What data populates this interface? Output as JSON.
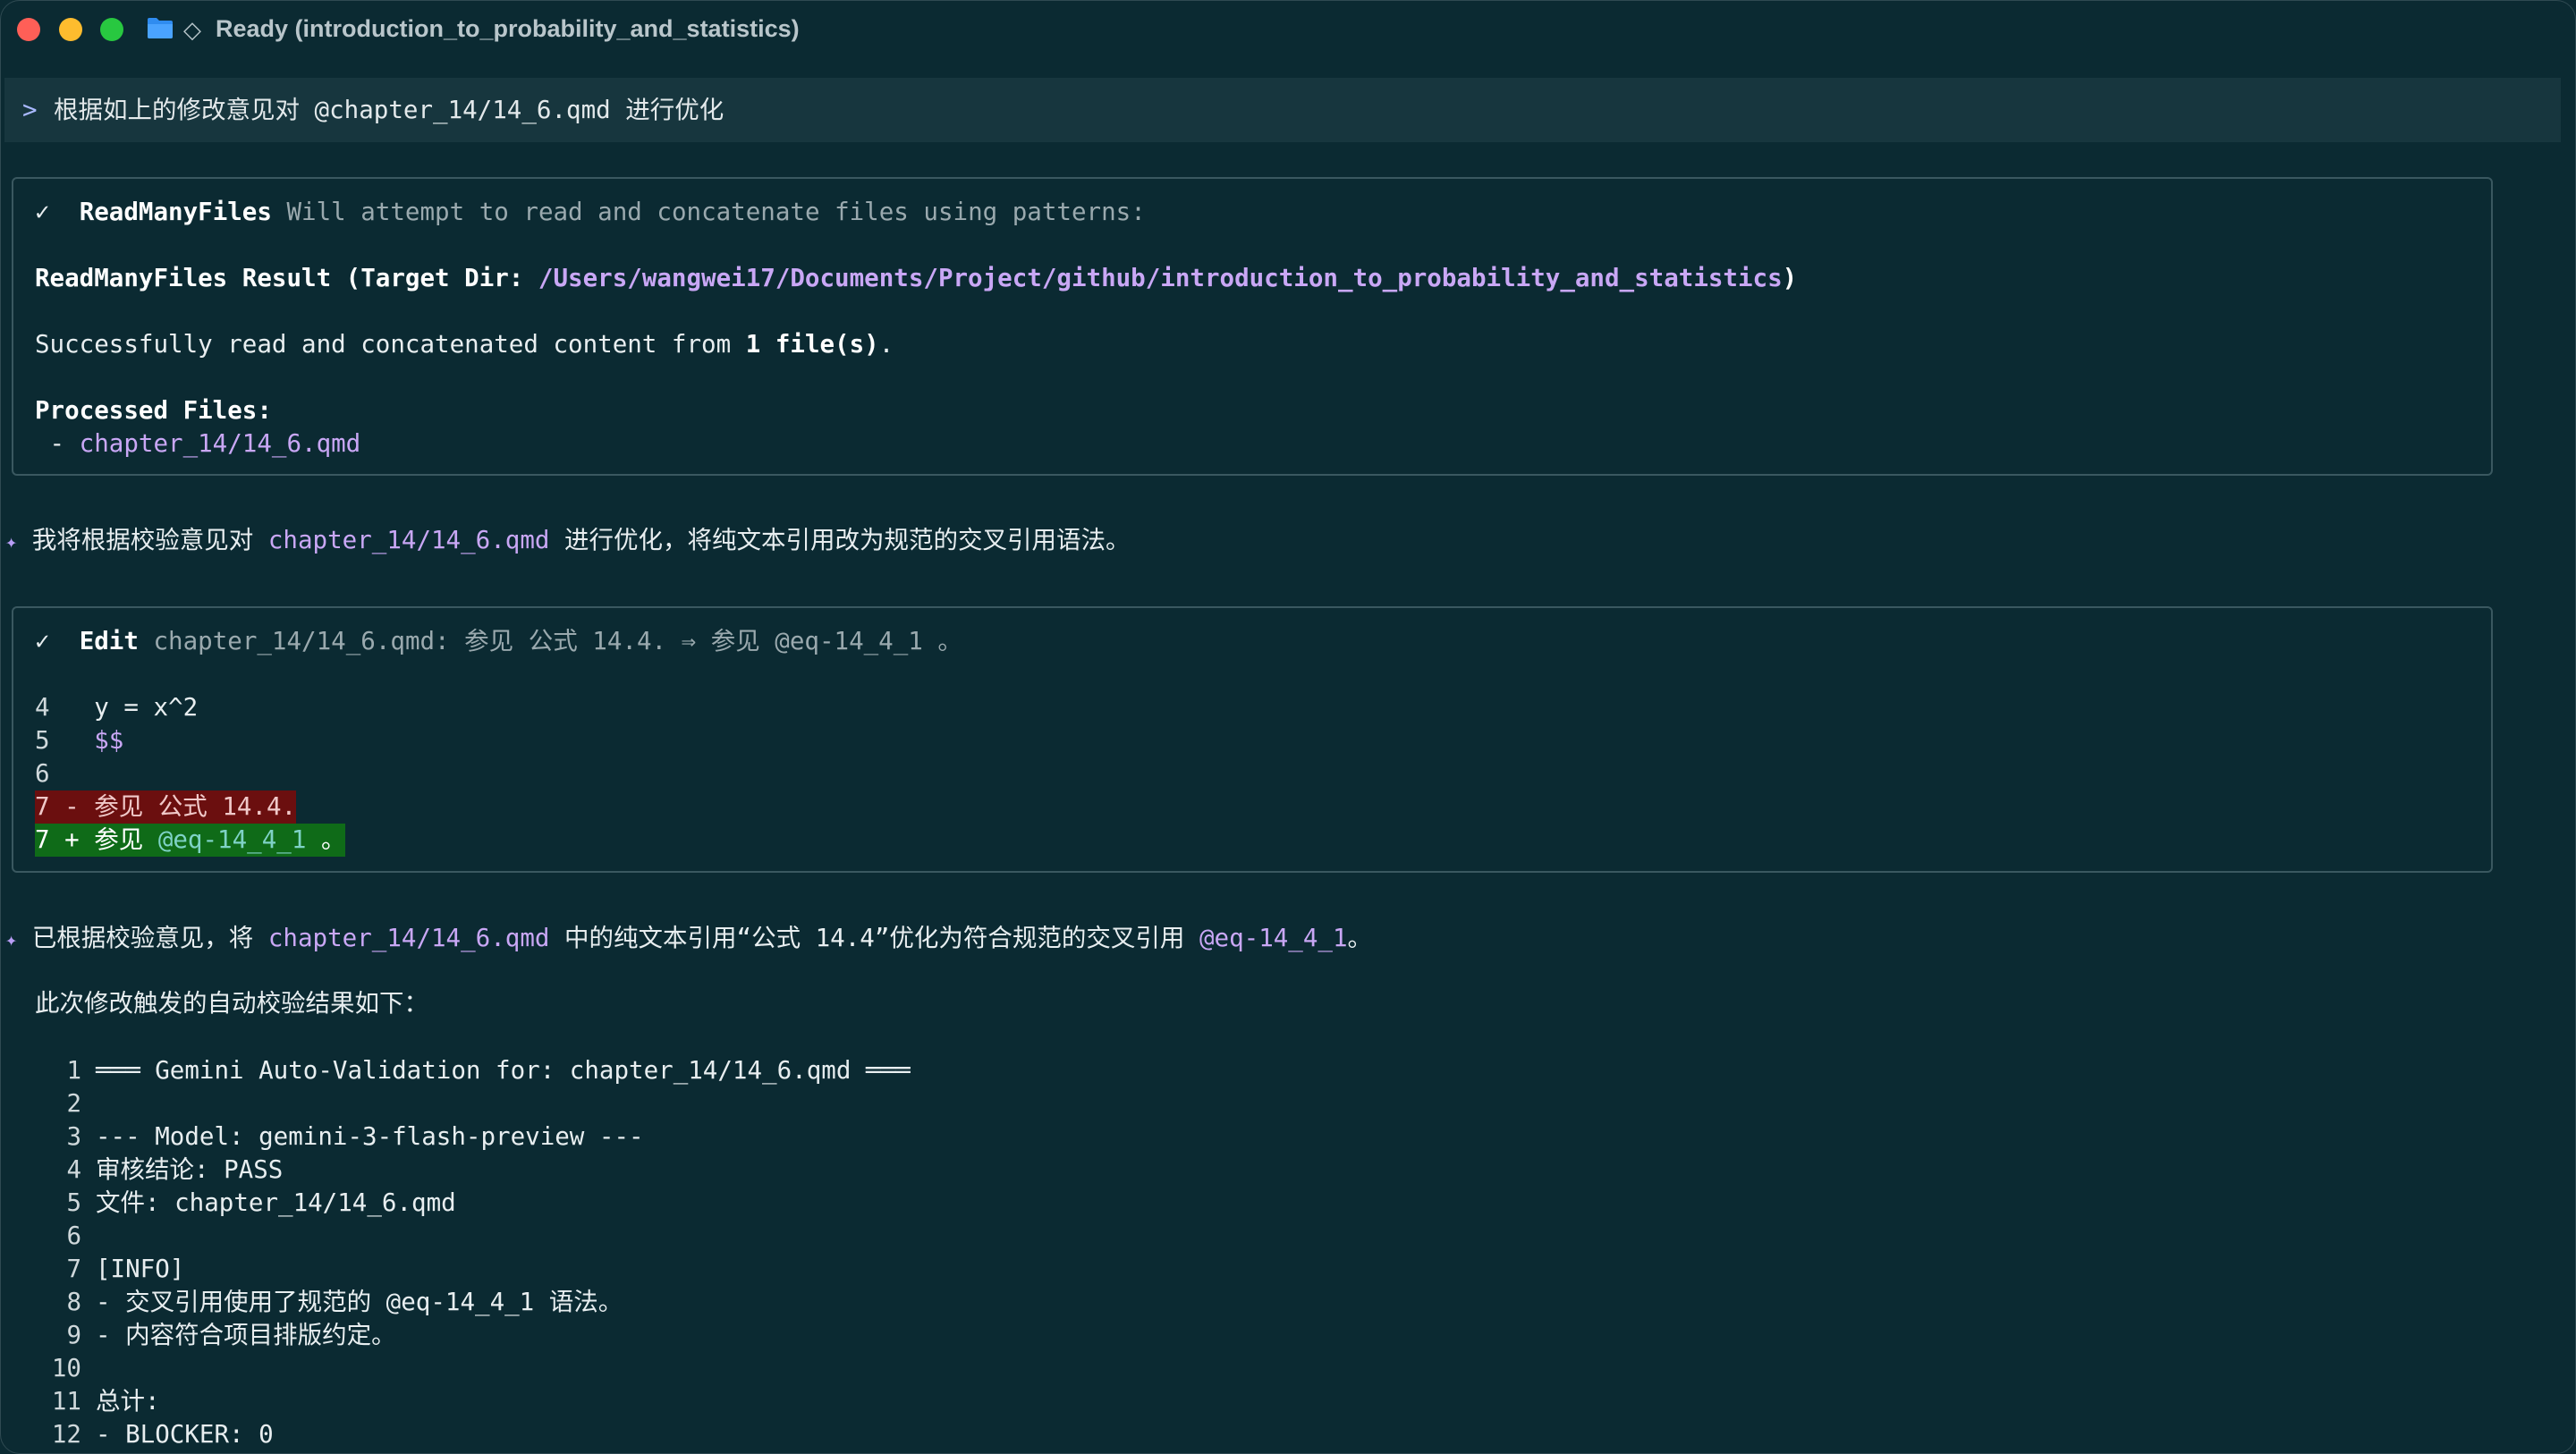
{
  "window": {
    "title": "◇ Ready (introduction_to_probability_and_statistics)",
    "title_text": "Ready (introduction_to_probability_and_statistics)"
  },
  "prompt": {
    "caret": ">",
    "text": "根据如上的修改意见对 @chapter_14/14_6.qmd 进行优化"
  },
  "read_tool": {
    "status_icon": "✓",
    "name": "ReadManyFiles",
    "description": "Will attempt to read and concatenate files using patterns:",
    "result_label": "ReadManyFiles Result (Target Dir: ",
    "target_dir": "/Users/wangwei17/Documents/Project/github/introduction_to_probability_and_statistics",
    "result_close": ")",
    "success_prefix": "Successfully read and concatenated content from ",
    "success_count": "1 file(s)",
    "success_suffix": ".",
    "processed_label": "Processed Files:",
    "files": [
      "chapter_14/14_6.qmd"
    ]
  },
  "assistant_msg_1": {
    "prefix": "我将根据校验意见对 ",
    "file": "chapter_14/14_6.qmd",
    "suffix": " 进行优化，将纯文本引用改为规范的交叉引用语法。"
  },
  "edit_tool": {
    "status_icon": "✓",
    "name": "Edit",
    "description": "chapter_14/14_6.qmd: 参见 公式 14.4. ⇒ 参见 @eq-14_4_1 。",
    "lines": [
      {
        "num": "4",
        "text": "y = x^2"
      },
      {
        "num": "5",
        "text": "$$"
      },
      {
        "num": "6",
        "text": ""
      }
    ],
    "removed": {
      "num": "7",
      "sign": "-",
      "text": "参见 公式 14.4."
    },
    "added": {
      "num": "7",
      "sign": "+",
      "text_a": "参见 ",
      "ref": "@eq-14_4_1",
      "text_b": " 。"
    }
  },
  "assistant_msg_2": {
    "p1": "已根据校验意见，将 ",
    "file": "chapter_14/14_6.qmd",
    "p2": " 中的纯文本引用“公式 14.4”优化为符合规范的交叉引用 ",
    "ref": "@eq-14_4_1",
    "p3": "。",
    "line2": "此次修改触发的自动校验结果如下："
  },
  "validation": {
    "lines": [
      {
        "num": "1",
        "text": "═══ Gemini Auto-Validation for: chapter_14/14_6.qmd ═══"
      },
      {
        "num": "2",
        "text": ""
      },
      {
        "num": "3",
        "text": "--- Model: gemini-3-flash-preview ---"
      },
      {
        "num": "4",
        "text": "审核结论: PASS"
      },
      {
        "num": "5",
        "text": "文件: chapter_14/14_6.qmd"
      },
      {
        "num": "6",
        "text": ""
      },
      {
        "num": "7",
        "text": "[INFO]"
      },
      {
        "num": "8",
        "text": "- 交叉引用使用了规范的 @eq-14_4_1 语法。"
      },
      {
        "num": "9",
        "text": "- 内容符合项目排版约定。"
      },
      {
        "num": "10",
        "text": ""
      },
      {
        "num": "11",
        "text": "总计:"
      },
      {
        "num": "12",
        "text": "- BLOCKER: 0"
      }
    ]
  },
  "colors": {
    "background": "#0b2a32",
    "accent_purple": "#c9a7f5",
    "diff_removed": "#6b0f0f",
    "diff_added": "#0f6b18"
  }
}
